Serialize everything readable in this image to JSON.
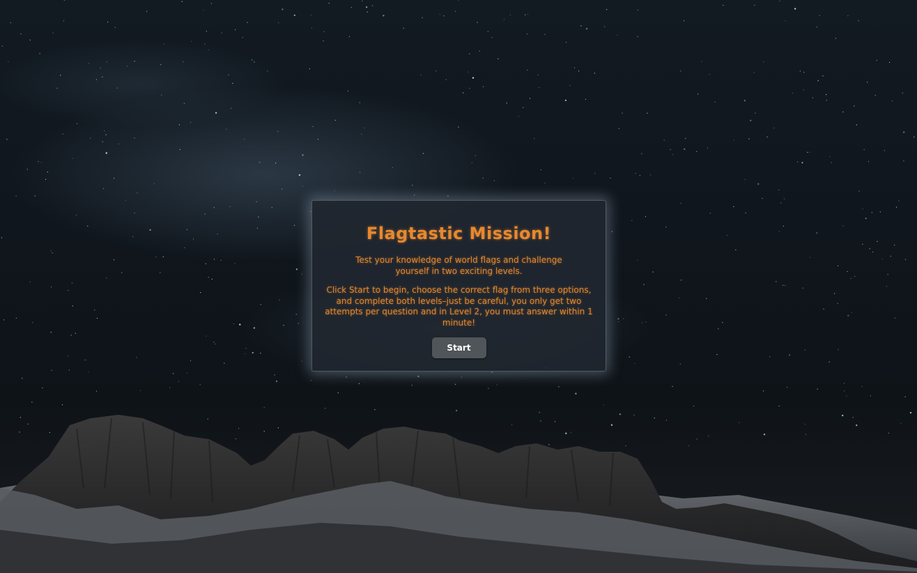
{
  "page": {
    "title": "Flagtastic Mission!",
    "intro": "Test your knowledge of world flags and challenge yourself in two exciting levels.",
    "instructions": "Click Start to begin, choose the correct flag from three options, and complete both levels–just be careful, you only get two attempts per question and in Level 2, you must answer within 1 minute!",
    "start_label": "Start"
  },
  "theme": {
    "accent": "#e8882e",
    "panel_bg": "#20272f",
    "button_bg": "#4f5559"
  },
  "background": {
    "description_icon": "night-sky-mountains-image"
  }
}
